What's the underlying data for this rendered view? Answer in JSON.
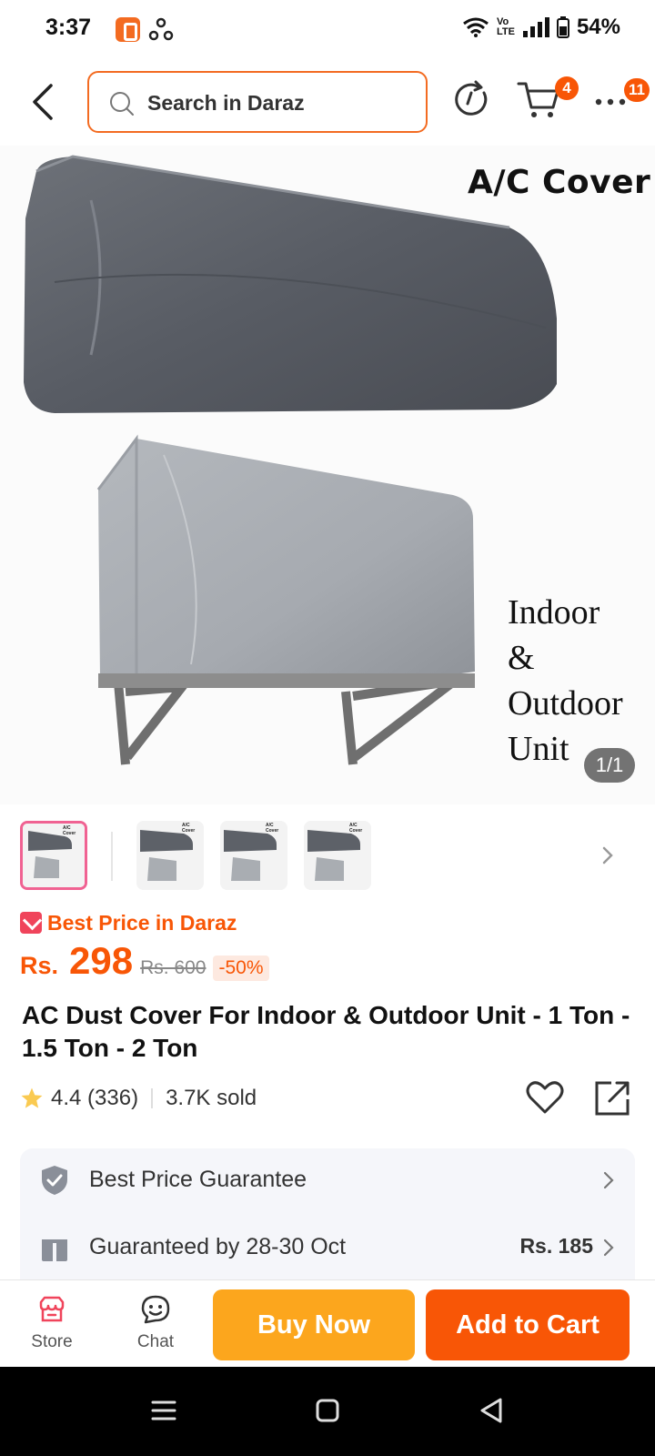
{
  "status_bar": {
    "time": "3:37",
    "network": "Vo LTE",
    "battery": "54%"
  },
  "header": {
    "search_placeholder": "Search in Daraz",
    "cart_count": "4",
    "more_count": "11"
  },
  "product_image": {
    "overlay_title": "A/C Cover",
    "overlay_caption": [
      "Indoor",
      "&",
      "Outdoor",
      "Unit"
    ],
    "counter": "1/1"
  },
  "thumbnails": [
    {
      "label": "A/C Cover"
    },
    {
      "label": "A/C Cover"
    },
    {
      "label": "A/C Cover"
    },
    {
      "label": "A/C Cover"
    }
  ],
  "price": {
    "badge_text": "Best Price in Daraz",
    "currency": "Rs.",
    "current": "298",
    "original": "Rs. 600",
    "discount": "-50%"
  },
  "product": {
    "title": "AC Dust Cover For Indoor & Outdoor Unit - 1 Ton - 1.5 Ton - 2 Ton",
    "rating": "4.4 (336)",
    "sold": "3.7K sold"
  },
  "services": [
    {
      "label": "Best Price Guarantee",
      "value": ""
    },
    {
      "label": "Guaranteed by 28-30 Oct",
      "value": "Rs. 185"
    }
  ],
  "bottom_bar": {
    "store_label": "Store",
    "chat_label": "Chat",
    "buy_now": "Buy Now",
    "add_to_cart": "Add to Cart"
  },
  "colors": {
    "brand": "#f85606",
    "buy_now": "#fca61d",
    "search_border": "#f36b21"
  }
}
